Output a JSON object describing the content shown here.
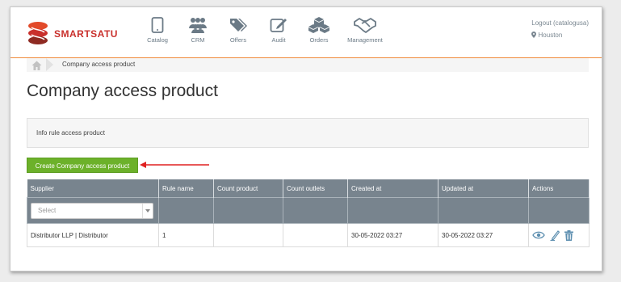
{
  "app": {
    "brand": "SMARTSATU",
    "colors": {
      "brand_red": "#c9302c",
      "accent_orange": "#f08b3c",
      "header_gray": "#78848e",
      "button_green": "#6cb12a",
      "annotation_red": "#e02020"
    }
  },
  "nav": {
    "items": [
      {
        "label": "Catalog",
        "icon": "tablet-icon"
      },
      {
        "label": "CRM",
        "icon": "users-icon"
      },
      {
        "label": "Offers",
        "icon": "tags-icon"
      },
      {
        "label": "Audit",
        "icon": "edit-icon"
      },
      {
        "label": "Orders",
        "icon": "boxes-icon"
      },
      {
        "label": "Management",
        "icon": "handshake-icon"
      }
    ]
  },
  "user": {
    "logout": "Logout (catalogusa)",
    "location": "Houston"
  },
  "breadcrumb": {
    "current": "Company access product"
  },
  "page": {
    "title": "Company access product",
    "info": "Info rule access product",
    "create_label": "Create Company access product"
  },
  "table": {
    "headers": [
      "Supplier",
      "Rule name",
      "Count product",
      "Count outlets",
      "Created at",
      "Updated at",
      "Actions"
    ],
    "filter": {
      "supplier_placeholder": "Select"
    },
    "rows": [
      {
        "supplier": "Distributor LLP | Distributor",
        "rule_name": "1",
        "count_product": "",
        "count_outlets": "",
        "created_at": "30-05-2022 03:27",
        "updated_at": "30-05-2022 03:27"
      }
    ]
  }
}
